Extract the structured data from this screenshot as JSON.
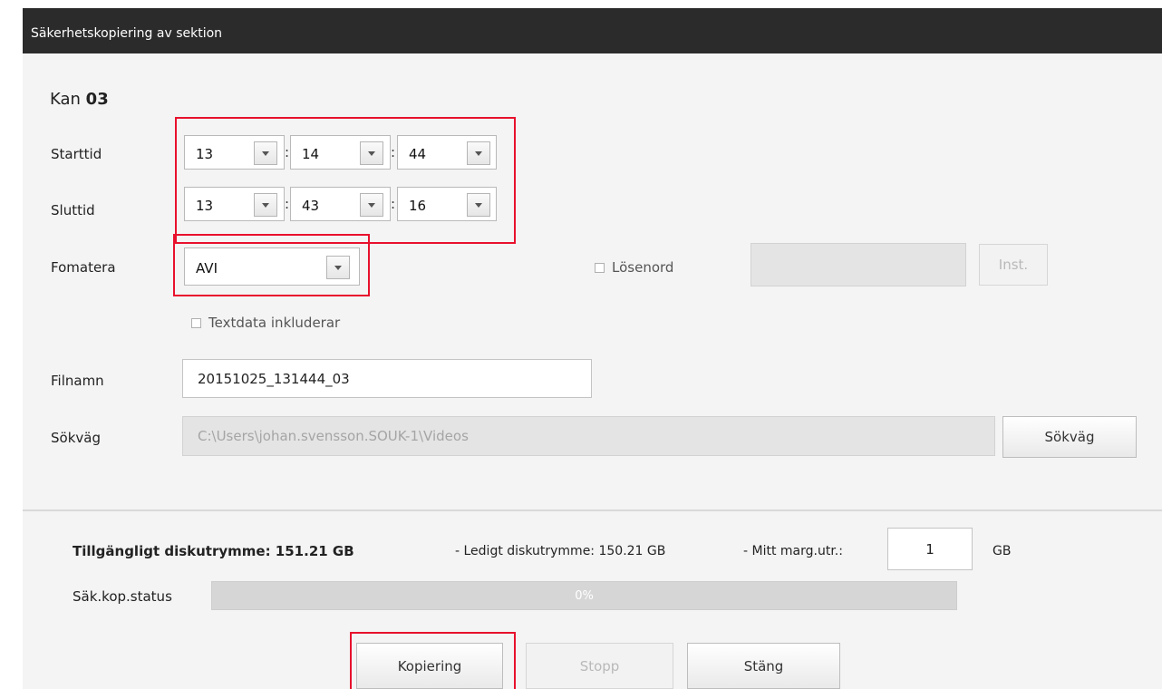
{
  "window": {
    "title": "Säkerhetskopiering av sektion"
  },
  "channel": {
    "prefix": "Kan",
    "number": "03"
  },
  "start_time": {
    "label": "Starttid",
    "hour": "13",
    "minute": "14",
    "second": "44",
    "separator": ":"
  },
  "end_time": {
    "label": "Sluttid",
    "hour": "13",
    "minute": "43",
    "second": "16",
    "separator": ":"
  },
  "format": {
    "label": "Fomatera",
    "value": "AVI"
  },
  "password": {
    "label": "Lösenord",
    "checked": false,
    "value": "",
    "button": "Inst."
  },
  "text_data": {
    "label": "Textdata inkluderar",
    "checked": false
  },
  "filename": {
    "label": "Filnamn",
    "value": "20151025_131444_03"
  },
  "path": {
    "label": "Sökväg",
    "value": "C:\\Users\\johan.svensson.SOUK-1\\Videos",
    "button": "Sökväg"
  },
  "disk": {
    "available": "Tillgängligt diskutrymme: 151.21 GB",
    "free": "- Ledigt diskutrymme: 150.21 GB",
    "margin_label": "- Mitt marg.utr.:",
    "margin_value": "1",
    "margin_unit": "GB"
  },
  "status": {
    "label": "Säk.kop.status",
    "progress_percent": 0,
    "progress_text": "0%"
  },
  "buttons": {
    "copy": "Kopiering",
    "stop": "Stopp",
    "close": "Stäng"
  },
  "colors": {
    "highlight": "#e8112d",
    "titlebar": "#2b2b2b"
  }
}
